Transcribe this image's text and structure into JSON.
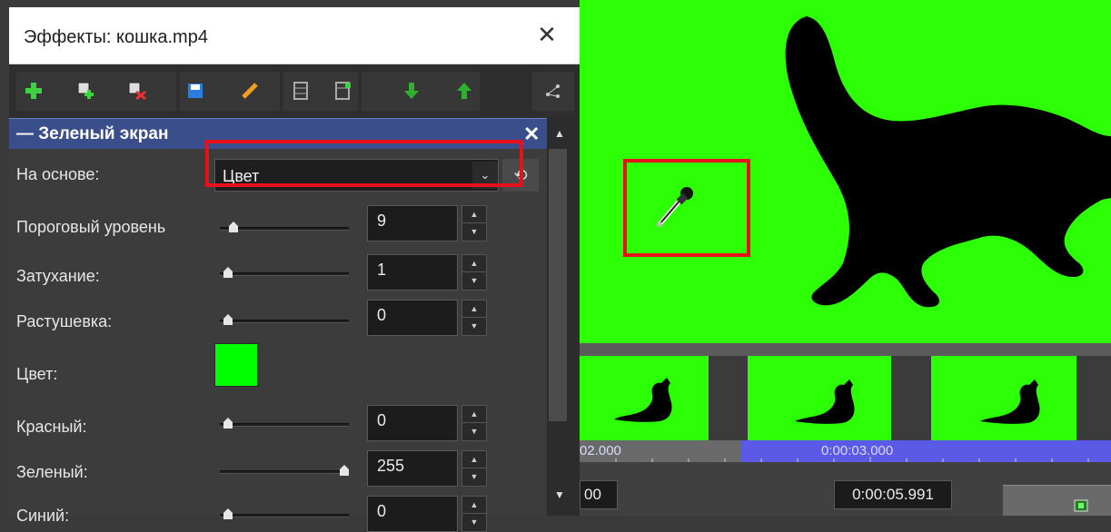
{
  "dialog": {
    "title": "Эффекты: кошка.mp4",
    "toolbar_icons": [
      "add-effect-icon",
      "add-keyframe-icon",
      "delete-keyframe-icon",
      "save-icon",
      "edit-pencil-icon",
      "film-frame-icon",
      "film-add-icon",
      "move-down-icon",
      "move-up-icon",
      "node-graph-icon"
    ]
  },
  "panel": {
    "title": "— Зеленый экран",
    "based_on_label": "На основе:",
    "based_on_value": "Цвет",
    "reset_glyph": "⟲",
    "params": [
      {
        "label": "Пороговый уровень",
        "value": "9",
        "fraction": 0.05
      },
      {
        "label": "Затухание:",
        "value": "1",
        "fraction": 0.0
      },
      {
        "label": "Растушевка:",
        "value": "0",
        "fraction": 0.0
      }
    ],
    "color_label": "Цвет:",
    "color_value": "#00ff00",
    "rgb": [
      {
        "label": "Красный:",
        "value": "0",
        "fraction": 0.0
      },
      {
        "label": "Зеленый:",
        "value": "255",
        "fraction": 1.0
      },
      {
        "label": "Синий:",
        "value": "0",
        "fraction": 0.0
      }
    ]
  },
  "timeline": {
    "ruler_left": "02.000",
    "ruler_mid": "0:00:03.000",
    "time_left": "00",
    "time_right": "0:00:05.991"
  },
  "colors": {
    "green_screen": "#2dff06",
    "highlight_red": "#e8101a",
    "header_blue": "#3b4e8c",
    "selection_blue": "#5a5ae6"
  }
}
